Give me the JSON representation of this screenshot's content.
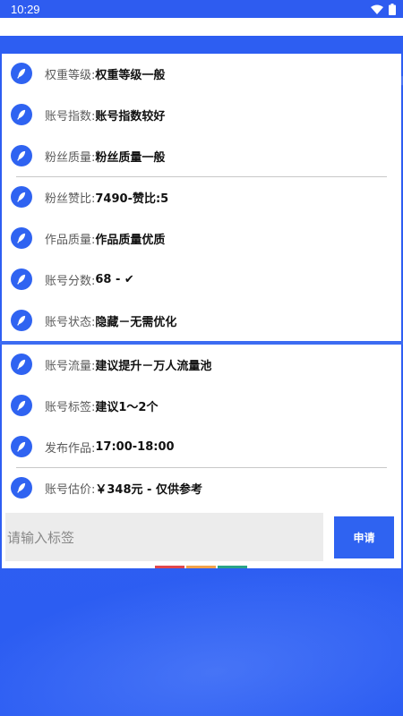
{
  "status_bar": {
    "time": "10:29",
    "icons": [
      "wifi-icon",
      "battery-icon"
    ]
  },
  "colors": {
    "accent": "#2f63f1",
    "background_blue": "#2d5ef2",
    "bar_red": "#e0474c",
    "bar_orange": "#f2a24a",
    "bar_green": "#2aa388"
  },
  "rows": [
    {
      "label": "权重等级:",
      "value": "权重等级一般",
      "icon": "feather-icon"
    },
    {
      "label": "账号指数:",
      "value": "账号指数较好",
      "icon": "feather-icon"
    },
    {
      "label": "粉丝质量:",
      "value": "粉丝质量一般",
      "icon": "feather-icon"
    },
    {
      "label": "粉丝赞比:",
      "value": "7490-赞比:5",
      "icon": "feather-icon"
    },
    {
      "label": "作品质量:",
      "value": "作品质量优质",
      "icon": "feather-icon"
    },
    {
      "label": "账号分数:",
      "value": "68 - ✔",
      "icon": "feather-icon"
    },
    {
      "label": "账号状态:",
      "value": "隐藏－无需优化",
      "icon": "feather-icon"
    },
    {
      "label": "账号流量:",
      "value": "建议提升－万人流量池",
      "icon": "feather-icon"
    },
    {
      "label": "账号标签:",
      "value": "建议1～2个",
      "icon": "feather-icon"
    },
    {
      "label": "发布作品:",
      "value": "17:00-18:00",
      "icon": "feather-icon"
    },
    {
      "label": "账号估价:",
      "value": "￥348元 - 仅供参考",
      "icon": "feather-icon"
    }
  ],
  "form": {
    "input_placeholder": "请输入标签",
    "input_value": "",
    "submit_label": "申请"
  }
}
